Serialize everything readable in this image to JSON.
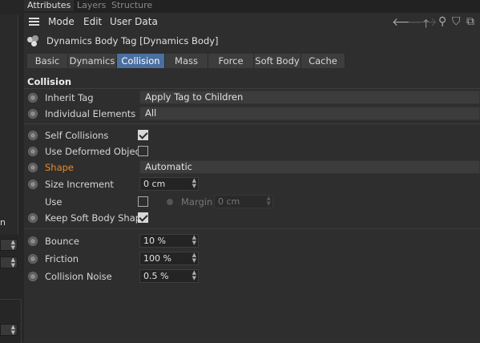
{
  "top_tabs": [
    "Attributes",
    "Layers",
    "Structure"
  ],
  "menu": [
    "Mode",
    "Edit",
    "User Data"
  ],
  "nav_icons": [
    "arrow-left-icon",
    "arrow-right-icon",
    "arrow-up-icon",
    "search-icon",
    "filter-icon",
    "new-panel-icon"
  ],
  "tag_title": "Dynamics Body Tag [Dynamics Body]",
  "tabs": [
    "Basic",
    "Dynamics",
    "Collision",
    "Mass",
    "Force",
    "Soft Body",
    "Cache"
  ],
  "active_tab": "Collision",
  "section_title": "Collision",
  "fields": {
    "inherit_tag": {
      "label": "Inherit Tag",
      "value": "Apply Tag to Children"
    },
    "individual_elements": {
      "label": "Individual Elements",
      "value": "All"
    },
    "self_collisions": {
      "label": "Self Collisions",
      "checked": true
    },
    "use_deformed_object": {
      "label": "Use Deformed Object",
      "checked": false
    },
    "shape": {
      "label": "Shape",
      "value": "Automatic"
    },
    "size_increment": {
      "label": "Size Increment",
      "value": "0 cm"
    },
    "use": {
      "label": "Use",
      "checked": false
    },
    "margin": {
      "label": "Margin",
      "value": "0 cm"
    },
    "keep_soft_body_shape": {
      "label": "Keep Soft Body Shape",
      "checked": true
    },
    "bounce": {
      "label": "Bounce",
      "value": "10 %"
    },
    "friction": {
      "label": "Friction",
      "value": "100 %"
    },
    "collision_noise": {
      "label": "Collision Noise",
      "value": "0.5 %"
    }
  },
  "left_panel": {
    "letter": "n"
  },
  "colors": {
    "accent_tab": "#4a6fa0",
    "highlight_label": "#e88a2e"
  }
}
